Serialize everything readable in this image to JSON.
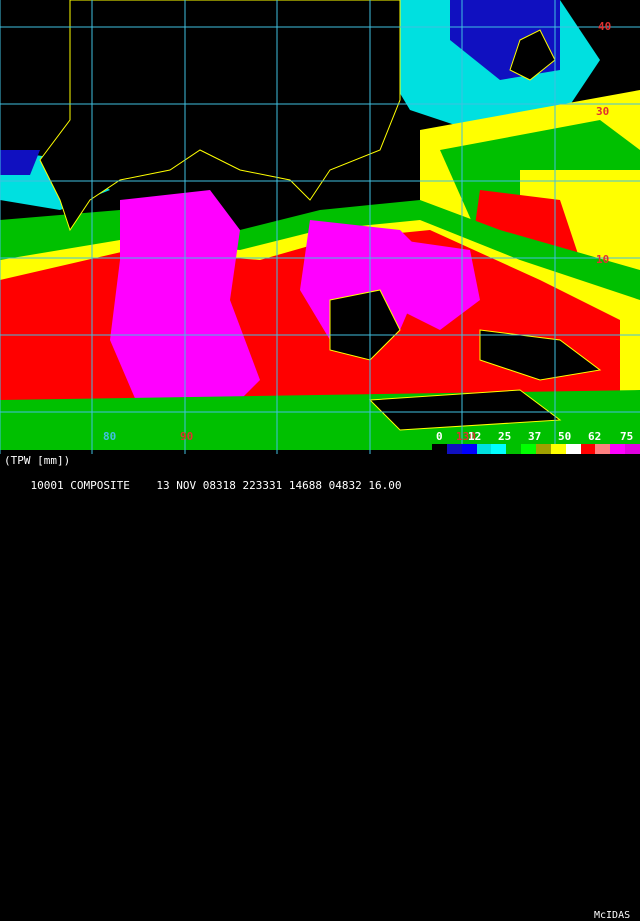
{
  "product": {
    "title": "(TPW [mm])",
    "composite_line": "10001 COMPOSITE",
    "date": "13 NOV 08318",
    "time": "223331",
    "codes": [
      "14688",
      "04832",
      "16.00"
    ],
    "software": "McIDAS"
  },
  "grid": {
    "lat_labels": [
      "40",
      "30",
      "10"
    ],
    "lon_labels": [
      "80",
      "90",
      "130"
    ]
  },
  "legend": {
    "labels": [
      "0",
      "12",
      "25",
      "37",
      "50",
      "62",
      "75"
    ],
    "colors": [
      "#000000",
      "#1010c0",
      "#0000ff",
      "#00e0e0",
      "#00ffff",
      "#00c000",
      "#00ff00",
      "#a0a000",
      "#ffff00",
      "#ffffff",
      "#ff0000",
      "#ff8080",
      "#ff00ff",
      "#e000e0"
    ]
  },
  "colors": {
    "grid": "#40c0e0",
    "coast": "#ffff00",
    "land": "#000000",
    "dry": "#00e0e0",
    "moist": "#00c000",
    "humid": "#ffff00",
    "wet": "#ff0000",
    "very_wet": "#ff00ff"
  }
}
